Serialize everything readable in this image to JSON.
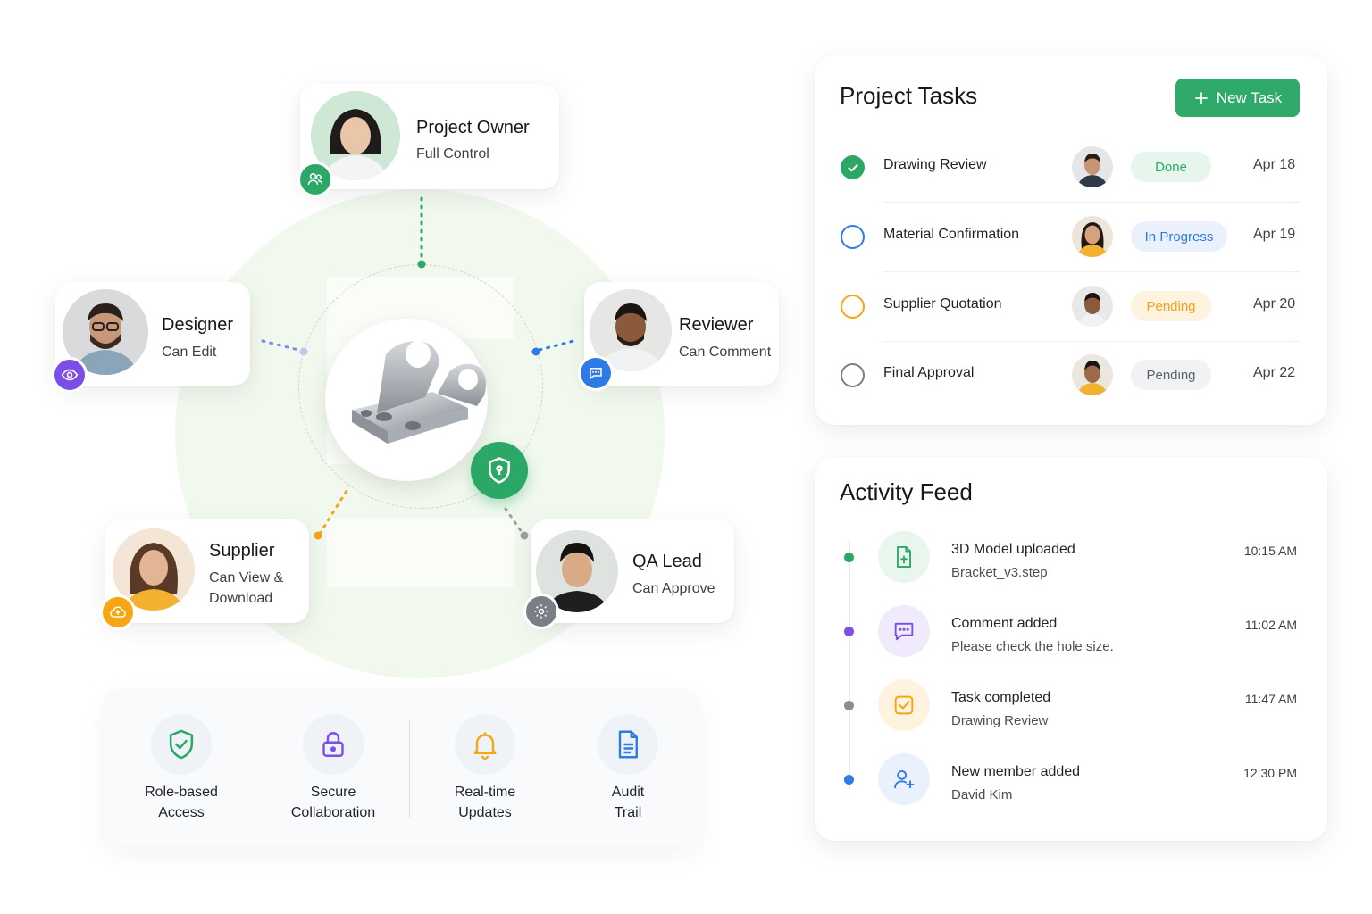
{
  "roles": [
    {
      "id": "owner",
      "title": "Project Owner",
      "subtitle": "Full Control",
      "badge_icon": "users-icon",
      "badge_color": "#2ba866"
    },
    {
      "id": "designer",
      "title": "Designer",
      "subtitle": "Can Edit",
      "badge_icon": "eye-icon",
      "badge_color": "#7b4ee8"
    },
    {
      "id": "reviewer",
      "title": "Reviewer",
      "subtitle": "Can Comment",
      "badge_icon": "chat-icon",
      "badge_color": "#2d7be5"
    },
    {
      "id": "supplier",
      "title": "Supplier",
      "subtitle_lines": [
        "Can View &",
        "Download"
      ],
      "badge_icon": "cloud-upload-icon",
      "badge_color": "#f5a612"
    },
    {
      "id": "qa",
      "title": "QA Lead",
      "subtitle": "Can Approve",
      "badge_icon": "gear-icon",
      "badge_color": "#7a7f85"
    }
  ],
  "center": {
    "object": "bracket-part",
    "badge_icon": "shield-lock-icon",
    "accent": "#2ba866"
  },
  "features": [
    {
      "label_lines": [
        "Role-based",
        "Access"
      ],
      "icon": "shield-check-icon",
      "color": "#2ba866"
    },
    {
      "label_lines": [
        "Secure",
        "Collaboration"
      ],
      "icon": "lock-icon",
      "color": "#7b4ee8"
    },
    {
      "label_lines": [
        "Real-time",
        "Updates"
      ],
      "icon": "bell-icon",
      "color": "#f5a612"
    },
    {
      "label_lines": [
        "Audit",
        "Trail"
      ],
      "icon": "document-icon",
      "color": "#2d7be5"
    }
  ],
  "tasks_panel": {
    "title": "Project Tasks",
    "new_task_label": "New Task",
    "tasks": [
      {
        "name": "Drawing Review",
        "status": "Done",
        "date": "Apr 18",
        "check": "done"
      },
      {
        "name": "Material Confirmation",
        "status": "In Progress",
        "date": "Apr 19",
        "check": "progress"
      },
      {
        "name": "Supplier Quotation",
        "status": "Pending",
        "date": "Apr 20",
        "check": "pending-orange"
      },
      {
        "name": "Final Approval",
        "status": "Pending",
        "date": "Apr 22",
        "check": "pending-gray"
      }
    ]
  },
  "activity_panel": {
    "title": "Activity Feed",
    "items": [
      {
        "title": "3D Model uploaded",
        "detail": "Bracket_v3.step",
        "time": "10:15 AM",
        "icon": "file-upload-icon",
        "color": "#2ba866"
      },
      {
        "title": "Comment added",
        "detail": "Please check the hole size.",
        "time": "11:02 AM",
        "icon": "comment-icon",
        "color": "#7b4ee8"
      },
      {
        "title": "Task completed",
        "detail": "Drawing Review",
        "time": "11:47 AM",
        "icon": "checkbox-icon",
        "color": "#f5a612"
      },
      {
        "title": "New member added",
        "detail": "David Kim",
        "time": "12:30 PM",
        "icon": "user-add-icon",
        "color": "#2d7be5"
      }
    ]
  },
  "colors": {
    "green": "#2ba866",
    "purple": "#7b4ee8",
    "blue": "#2d7be5",
    "orange": "#f5a612",
    "gray": "#7a7f85"
  }
}
